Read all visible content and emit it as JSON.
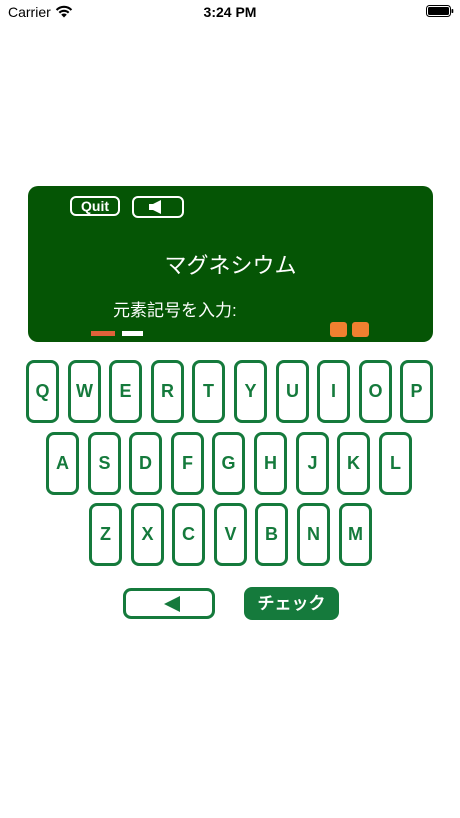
{
  "status_bar": {
    "carrier": "Carrier",
    "time": "3:24 PM"
  },
  "board": {
    "quit_label": "Quit",
    "element_name": "マグネシウム",
    "prompt": "元素記号を入力:",
    "sound_icon": "speaker-icon"
  },
  "keyboard": {
    "row1": [
      "Q",
      "W",
      "E",
      "R",
      "T",
      "Y",
      "U",
      "I",
      "O",
      "P"
    ],
    "row2": [
      "A",
      "S",
      "D",
      "F",
      "G",
      "H",
      "J",
      "K",
      "L"
    ],
    "row3": [
      "Z",
      "X",
      "C",
      "V",
      "B",
      "N",
      "M"
    ],
    "back_icon": "left-arrow-icon",
    "check_label": "チェック"
  },
  "colors": {
    "board": "#055505",
    "key_accent": "#157a3c",
    "error_dash": "#e0623a",
    "score_block": "#f08030"
  }
}
